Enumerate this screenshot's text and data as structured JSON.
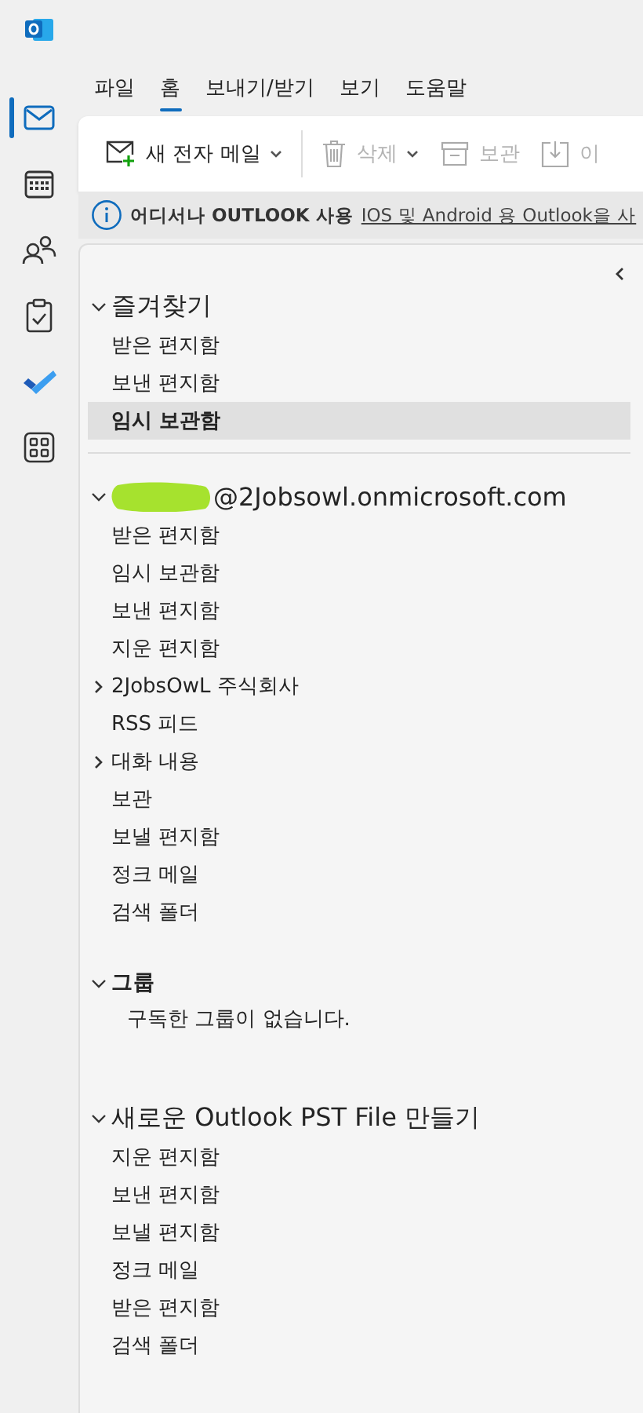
{
  "rail": [
    {
      "kind": "mail",
      "selected": true
    },
    {
      "kind": "calendar",
      "selected": false
    },
    {
      "kind": "people",
      "selected": false
    },
    {
      "kind": "tasks",
      "selected": false
    },
    {
      "kind": "todo",
      "selected": false
    },
    {
      "kind": "apps",
      "selected": false
    }
  ],
  "menu_tabs": [
    {
      "label": "파일",
      "selected": false
    },
    {
      "label": "홈",
      "selected": true
    },
    {
      "label": "보내기/받기",
      "selected": false
    },
    {
      "label": "보기",
      "selected": false
    },
    {
      "label": "도움말",
      "selected": false
    }
  ],
  "ribbon": [
    {
      "kind": "new-mail",
      "label": "새 전자 메일",
      "dropdown": true,
      "disabled": false
    },
    {
      "kind": "delete",
      "label": "삭제",
      "dropdown": true,
      "disabled": true
    },
    {
      "kind": "archive",
      "label": "보관",
      "dropdown": false,
      "disabled": true
    },
    {
      "kind": "move",
      "label": "이",
      "dropdown": false,
      "disabled": true
    }
  ],
  "info_bar": {
    "title": "어디서나 OUTLOOK 사용",
    "link": "IOS 및 Android 용 Outlook을 사"
  },
  "folder_sections": [
    {
      "title": "즐겨찾기",
      "expanded": true,
      "kind": "favorites",
      "items": [
        {
          "label": "받은 편지함",
          "kind": "folder",
          "selected": false
        },
        {
          "label": "보낸 편지함",
          "kind": "folder",
          "selected": false
        },
        {
          "label": "임시 보관함",
          "kind": "folder",
          "selected": true
        }
      ]
    },
    {
      "title": "@2Jobsowl.onmicrosoft.com",
      "expanded": true,
      "kind": "account",
      "redacted": true,
      "items": [
        {
          "label": "받은 편지함",
          "kind": "folder",
          "selected": false
        },
        {
          "label": "임시 보관함",
          "kind": "folder",
          "selected": false
        },
        {
          "label": "보낸 편지함",
          "kind": "folder",
          "selected": false
        },
        {
          "label": "지운 편지함",
          "kind": "folder",
          "selected": false
        },
        {
          "label": "2JobsOwL 주식회사",
          "kind": "parent",
          "expanded": false,
          "selected": false
        },
        {
          "label": "RSS 피드",
          "kind": "folder",
          "selected": false
        },
        {
          "label": "대화 내용",
          "kind": "parent",
          "expanded": false,
          "selected": false
        },
        {
          "label": "보관",
          "kind": "folder",
          "selected": false
        },
        {
          "label": "보낼 편지함",
          "kind": "folder",
          "selected": false
        },
        {
          "label": "정크 메일",
          "kind": "folder",
          "selected": false
        },
        {
          "label": "검색 폴더",
          "kind": "folder",
          "selected": false
        }
      ]
    },
    {
      "title": "그룹",
      "expanded": true,
      "kind": "groups",
      "note": "구독한 그룹이 없습니다."
    },
    {
      "title": "새로운 Outlook PST File 만들기",
      "expanded": true,
      "kind": "account",
      "items": [
        {
          "label": "지운 편지함",
          "kind": "folder",
          "selected": false
        },
        {
          "label": "보낸 편지함",
          "kind": "folder",
          "selected": false
        },
        {
          "label": "보낼 편지함",
          "kind": "folder",
          "selected": false
        },
        {
          "label": "정크 메일",
          "kind": "folder",
          "selected": false
        },
        {
          "label": "받은 편지함",
          "kind": "folder",
          "selected": false
        },
        {
          "label": "검색 폴더",
          "kind": "folder",
          "selected": false
        }
      ]
    }
  ]
}
